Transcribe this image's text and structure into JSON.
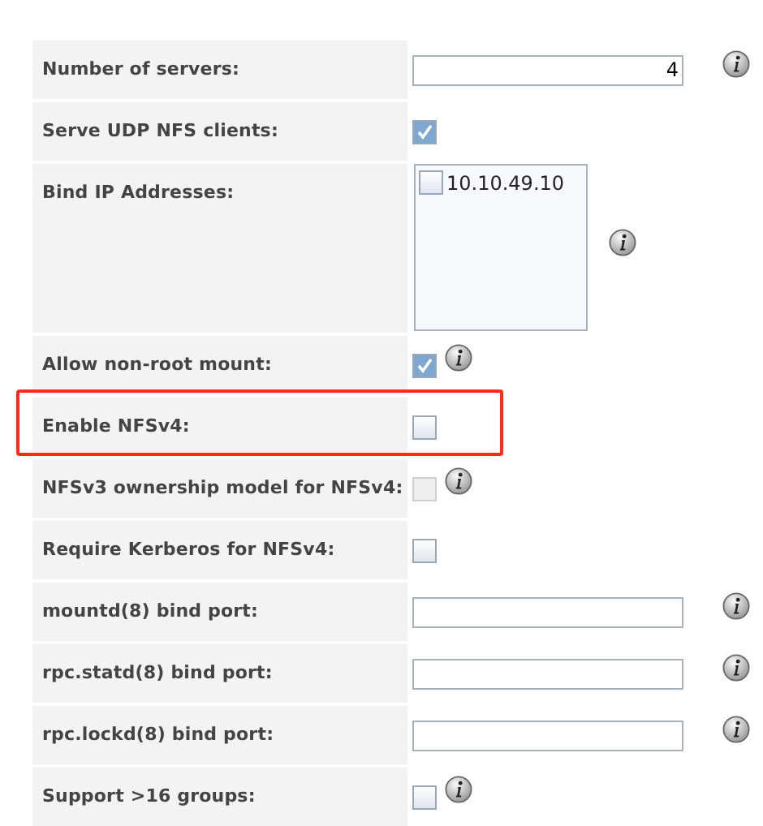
{
  "rows": [
    {
      "label": "Number of servers:",
      "kind": "text",
      "value": "4",
      "info": true,
      "highlighted": false
    },
    {
      "label": "Serve UDP NFS clients:",
      "kind": "checkbox",
      "checked": true,
      "disabled": false,
      "info": false,
      "highlighted": false
    },
    {
      "label": "Bind IP Addresses:",
      "kind": "listbox",
      "options": [
        {
          "label": "10.10.49.10",
          "checked": false
        }
      ],
      "info": true,
      "highlighted": false
    },
    {
      "label": "Allow non-root mount:",
      "kind": "checkbox",
      "checked": true,
      "disabled": false,
      "info": true,
      "highlighted": false
    },
    {
      "label": "Enable NFSv4:",
      "kind": "checkbox",
      "checked": false,
      "disabled": false,
      "info": false,
      "highlighted": true
    },
    {
      "label": "NFSv3 ownership model for NFSv4:",
      "kind": "checkbox",
      "checked": false,
      "disabled": true,
      "info": true,
      "highlighted": false
    },
    {
      "label": "Require Kerberos for NFSv4:",
      "kind": "checkbox",
      "checked": false,
      "disabled": false,
      "info": false,
      "highlighted": false
    },
    {
      "label": "mountd(8) bind port:",
      "kind": "text",
      "value": "",
      "info": true,
      "highlighted": false
    },
    {
      "label": "rpc.statd(8) bind port:",
      "kind": "text",
      "value": "",
      "info": true,
      "highlighted": false
    },
    {
      "label": "rpc.lockd(8) bind port:",
      "kind": "text",
      "value": "",
      "info": true,
      "highlighted": false
    },
    {
      "label": "Support >16 groups:",
      "kind": "checkbox",
      "checked": false,
      "disabled": false,
      "info": true,
      "highlighted": false
    }
  ]
}
